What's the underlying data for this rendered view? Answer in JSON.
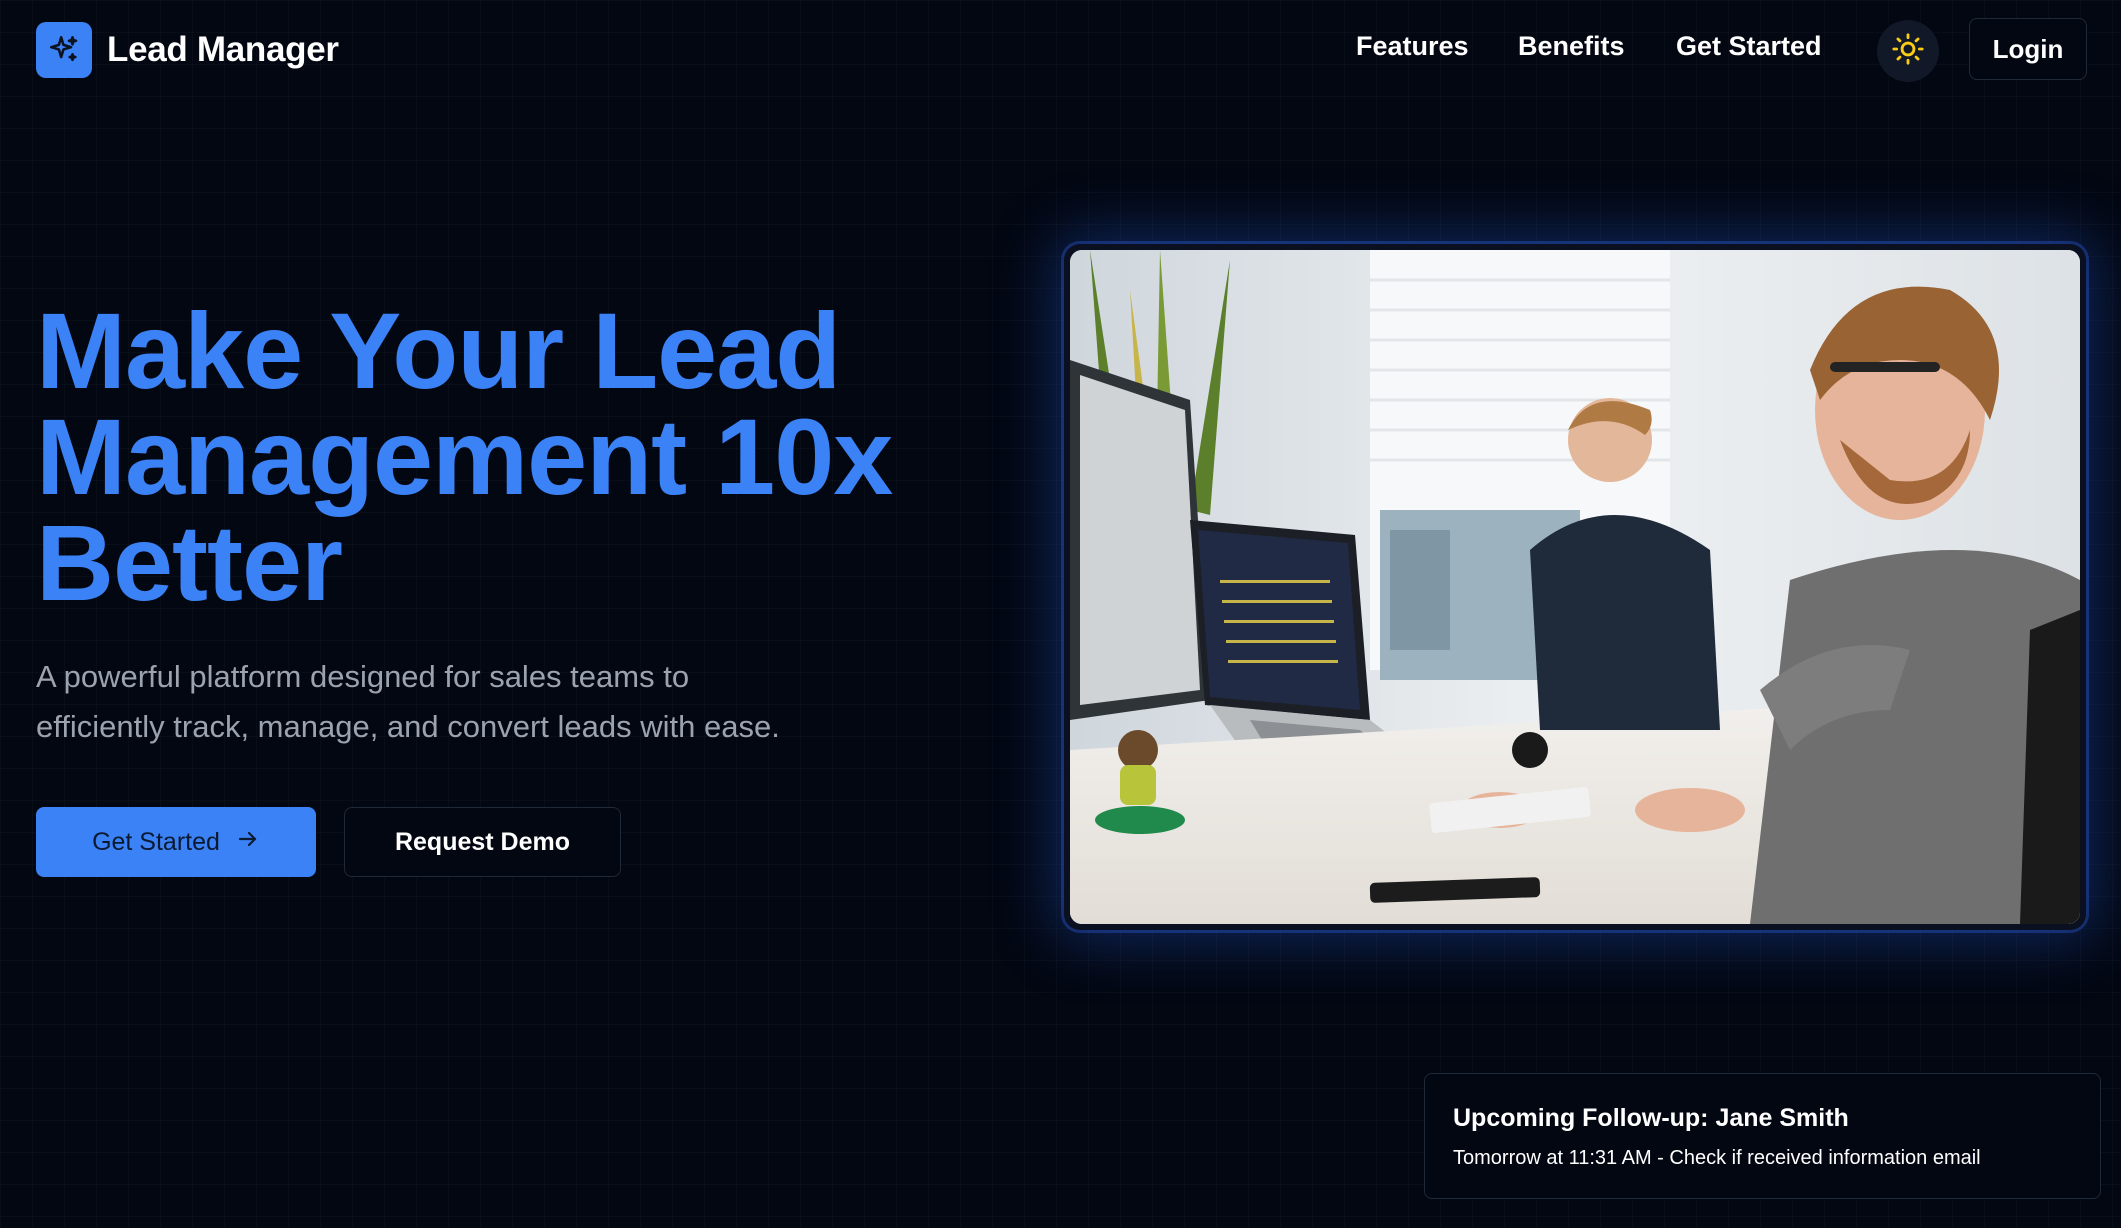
{
  "brand": {
    "name": "Lead Manager",
    "logo_icon": "sparkles-icon",
    "accent_color": "#3b82f6"
  },
  "nav": {
    "links": [
      {
        "label": "Features"
      },
      {
        "label": "Benefits"
      },
      {
        "label": "Get Started"
      }
    ],
    "theme_toggle_icon": "sun-icon",
    "login_label": "Login"
  },
  "hero": {
    "title_lines": [
      "Make Your Lead",
      "Management 10x",
      "Better"
    ],
    "subtitle_lines": [
      "A powerful platform designed for sales teams to",
      "efficiently track, manage, and convert leads with ease."
    ],
    "primary_button": "Get Started",
    "primary_button_icon": "arrow-right-icon",
    "secondary_button": "Request Demo"
  },
  "notification": {
    "title": "Upcoming Follow-up: Jane Smith",
    "text": "Tomorrow at 11:31 AM - Check if received information email"
  },
  "colors": {
    "background": "#030712",
    "accent": "#3b82f6",
    "muted_text": "#9ca3af",
    "border": "#1f2937",
    "sun_icon": "#facc15"
  }
}
